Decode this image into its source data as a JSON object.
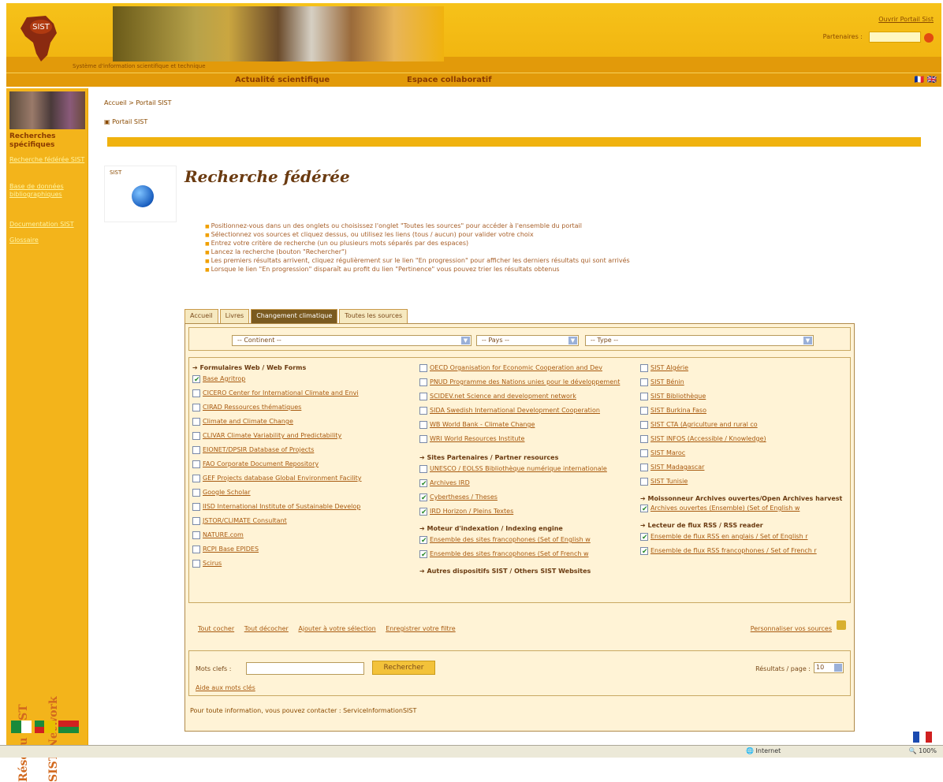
{
  "header": {
    "tagline": "Système d'information scientifique et technique",
    "top_link": "Ouvrir Portail Sist",
    "personalize_label": "Partenaires :"
  },
  "nav": {
    "items": [
      "Actualité scientifique",
      "Espace collaboratif"
    ],
    "lang_flags": "🇫🇷 🇬🇧"
  },
  "sidebar": {
    "title": "Recherches spécifiques",
    "links": [
      "Recherche fédérée SIST",
      "Base de données bibliographiques",
      "Documentation SIST",
      "Glossaire"
    ],
    "vertical_1": "Réseau SIST",
    "vertical_2": "SIST Network"
  },
  "main": {
    "breadcrumb": "Accueil > Portail SIST",
    "subtitle": "Portail SIST",
    "icon_label": "SIST",
    "page_title": "Recherche fédérée",
    "instructions": [
      "Positionnez-vous dans un des onglets ou choisissez l'onglet \"Toutes les sources\" pour accéder à l'ensemble du portail",
      "Sélectionnez vos sources et cliquez dessus, ou utilisez les liens (tous / aucun) pour valider votre choix",
      "Entrez votre critère de recherche (un ou plusieurs mots séparés par des espaces)",
      "Lancez la recherche (bouton \"Rechercher\")",
      "Les premiers résultats arrivent, cliquez régulièrement sur le lien \"En progression\" pour afficher les derniers résultats qui sont arrivés",
      "Lorsque le lien \"En progression\" disparaît au profit du lien \"Pertinence\" vous pouvez trier les résultats obtenus"
    ]
  },
  "tabs": [
    "Accueil",
    "Livres",
    "Changement climatique",
    "Toutes les sources"
  ],
  "filters": {
    "continent": "-- Continent --",
    "country": "-- Pays --",
    "type": "-- Type --"
  },
  "sources": {
    "col1": {
      "heading": "➔ Formulaires Web / Web Forms",
      "items": [
        {
          "label": "Base Agritrop",
          "checked": true
        },
        {
          "label": "CICERO Center for International Climate and Envi",
          "checked": false
        },
        {
          "label": "CIRAD Ressources thématiques",
          "checked": false
        },
        {
          "label": "Climate and Climate Change",
          "checked": false
        },
        {
          "label": "CLIVAR Climate Variability and Predictability",
          "checked": false
        },
        {
          "label": "EIONET/DPSIR Database of Projects",
          "checked": false
        },
        {
          "label": "FAO Corporate Document Repository",
          "checked": false
        },
        {
          "label": "GEF Projects database Global Environment Facility",
          "checked": false
        },
        {
          "label": "Google Scholar",
          "checked": false
        },
        {
          "label": "IISD International Institute of Sustainable Develop",
          "checked": false
        },
        {
          "label": "JSTOR/CLIMATE Consultant",
          "checked": false
        },
        {
          "label": "NATURE.com",
          "checked": false
        },
        {
          "label": "RCPI Base EPIDES",
          "checked": false
        },
        {
          "label": "Scirus",
          "checked": false
        }
      ]
    },
    "col2": {
      "items_top": [
        {
          "label": "OECD Organisation for Economic Cooperation and Dev",
          "checked": false
        },
        {
          "label": "PNUD Programme des Nations unies pour le développement",
          "checked": false
        },
        {
          "label": "SCIDEV.net Science and development network",
          "checked": false
        },
        {
          "label": "SIDA Swedish International Development Cooperation",
          "checked": false
        },
        {
          "label": "WB World Bank - Climate Change",
          "checked": false
        },
        {
          "label": "WRI World Resources Institute",
          "checked": false
        }
      ],
      "heading_partners": "➔ Sites Partenaires / Partner resources",
      "items_partners": [
        {
          "label": "UNESCO / EOLSS Bibliothèque numérique internationale",
          "checked": false
        },
        {
          "label": "Archives IRD",
          "checked": true
        },
        {
          "label": "Cybertheses / Theses",
          "checked": true
        },
        {
          "label": "IRD Horizon / Pleins Textes",
          "checked": true
        }
      ],
      "heading_index": "➔ Moteur d'indexation / Indexing engine",
      "items_index": [
        {
          "label": "Ensemble des sites francophones (Set of English w",
          "checked": true
        },
        {
          "label": "Ensemble des sites francophones (Set of French w",
          "checked": true
        }
      ],
      "heading_other": "➔ Autres dispositifs SIST / Others SIST Websites"
    },
    "col3": {
      "items_top": [
        {
          "label": "SIST Algérie",
          "checked": false
        },
        {
          "label": "SIST Bénin",
          "checked": false
        },
        {
          "label": "SIST Bibliothèque",
          "checked": false
        },
        {
          "label": "SIST Burkina Faso",
          "checked": false
        },
        {
          "label": "SIST CTA (Agriculture and rural co",
          "checked": false
        },
        {
          "label": "SIST INFOS (Accessible / Knowledge)",
          "checked": false
        },
        {
          "label": "SIST Maroc",
          "checked": false
        },
        {
          "label": "SIST Madagascar",
          "checked": false
        },
        {
          "label": "SIST Tunisie",
          "checked": false
        }
      ],
      "heading_archives": "➔ Moissonneur Archives ouvertes/Open Archives harvest",
      "items_archives": [
        {
          "label": "Archives ouvertes (Ensemble) (Set of English w",
          "checked": true
        }
      ],
      "heading_rss": "➔ Lecteur de flux RSS / RSS reader",
      "items_rss": [
        {
          "label": "Ensemble de flux RSS en anglais / Set of English r",
          "checked": true
        },
        {
          "label": "Ensemble de flux RSS francophones / Set of French r",
          "checked": true
        }
      ]
    }
  },
  "actions": [
    "Tout cocher",
    "Tout décocher",
    "Ajouter à votre sélection",
    "Enregistrer votre filtre"
  ],
  "personalize": "Personnaliser vos sources",
  "query": {
    "label": "Mots clefs :",
    "value": "",
    "button": "Rechercher",
    "help": "Aide aux mots clés",
    "results_label": "Résultats / page :",
    "results_value": "10"
  },
  "contact": "Pour toute information, vous pouvez contacter : ServiceInformationSIST",
  "statusbar": {
    "zone": "Internet",
    "zoom": "100%"
  },
  "colors": {
    "header_yellow": "#f0b20e",
    "nav_orange": "#e29a0a",
    "panel_bg": "#fff3d6",
    "active_tab": "#7a5a20"
  }
}
